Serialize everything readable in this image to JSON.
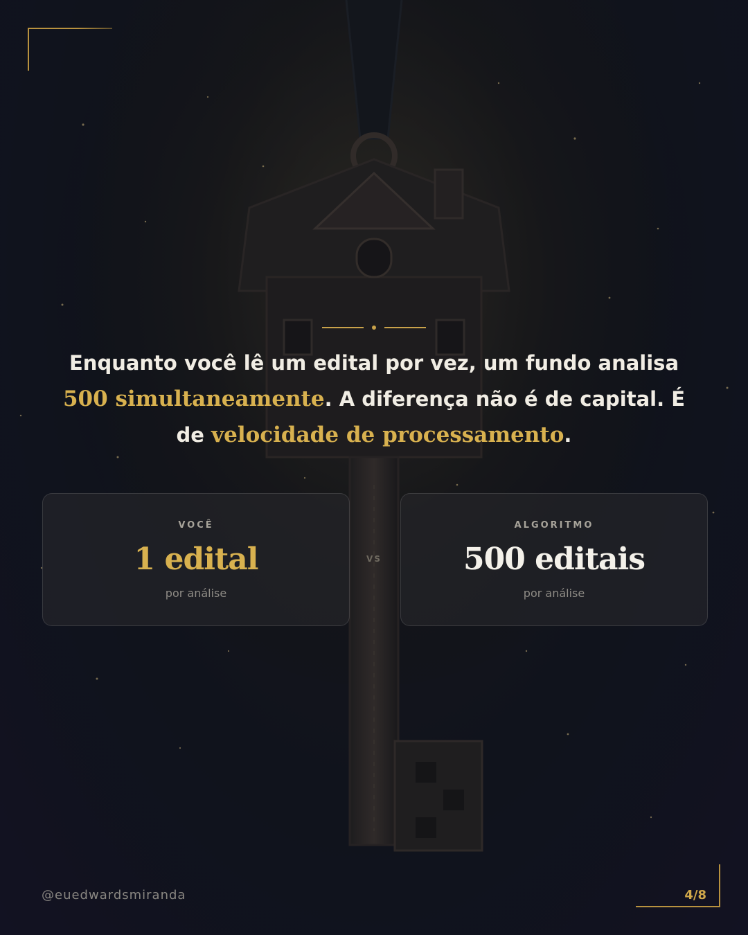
{
  "headline": {
    "part1": "Enquanto você lê um edital por vez, um fundo analisa ",
    "highlight1": "500 simultaneamente",
    "part2": ". A diferença não é de capital. É de ",
    "highlight2": "velocidade de processamento",
    "part3": "."
  },
  "comparison": {
    "left": {
      "label": "VOCÊ",
      "value": "1 edital",
      "sub": "por análise"
    },
    "vs": "VS",
    "right": {
      "label": "ALGORITMO",
      "value": "500 editais",
      "sub": "por análise"
    }
  },
  "footer": {
    "handle": "@euedwardsmiranda",
    "page": "4/8"
  },
  "colors": {
    "accent_gold": "#d8b14f",
    "text_light": "#f1ede4",
    "background_dark": "#111420"
  },
  "icons": [
    "house-key-illustration",
    "divider-ornament"
  ]
}
